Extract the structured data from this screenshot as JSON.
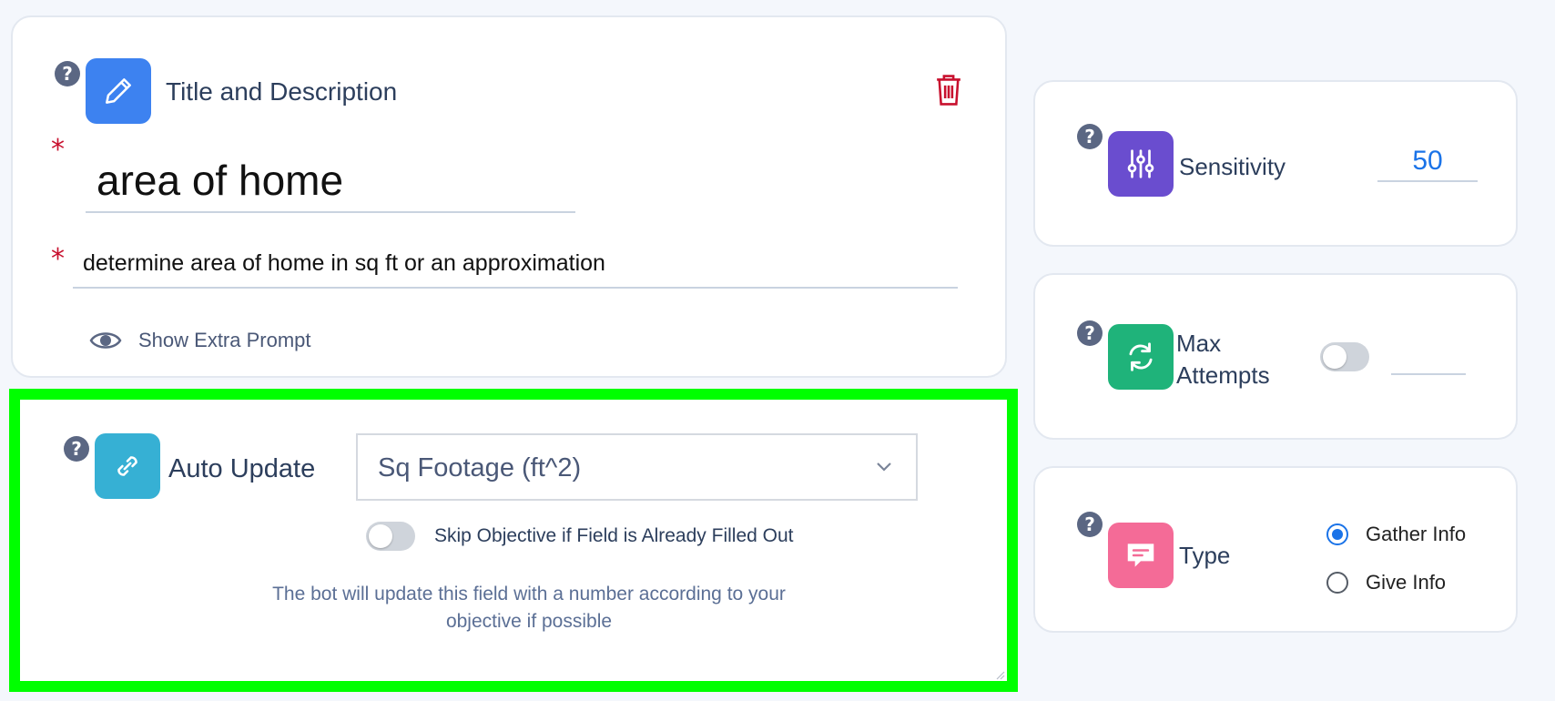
{
  "title_card": {
    "heading": "Title and Description",
    "title_value": "area of home",
    "description_value": "determine area of home in sq ft or an approximation",
    "required_mark": "*",
    "extra_prompt_label": "Show Extra Prompt"
  },
  "auto_update": {
    "heading": "Auto Update",
    "selected_field": "Sq Footage (ft^2)",
    "skip_label": "Skip Objective if Field is Already Filled Out",
    "skip_enabled": false,
    "info_text_line1": "The bot will update this field with a number according to your",
    "info_text_line2": "objective if possible"
  },
  "sensitivity": {
    "label": "Sensitivity",
    "value": "50"
  },
  "max_attempts": {
    "label_line1": "Max",
    "label_line2": "Attempts",
    "enabled": false,
    "value": ""
  },
  "type": {
    "label": "Type",
    "options": [
      "Gather Info",
      "Give Info"
    ],
    "selected": "Gather Info"
  },
  "help_glyph": "?",
  "colors": {
    "pencil_tile": "#3d82f0",
    "link_tile": "#36b0d4",
    "sensitivity_tile": "#6a4dcf",
    "attempts_tile": "#1fb37a",
    "type_tile": "#f46b97",
    "delete_icon": "#c8102e",
    "highlight_border": "#00ff00",
    "accent_blue": "#1a73e8"
  }
}
